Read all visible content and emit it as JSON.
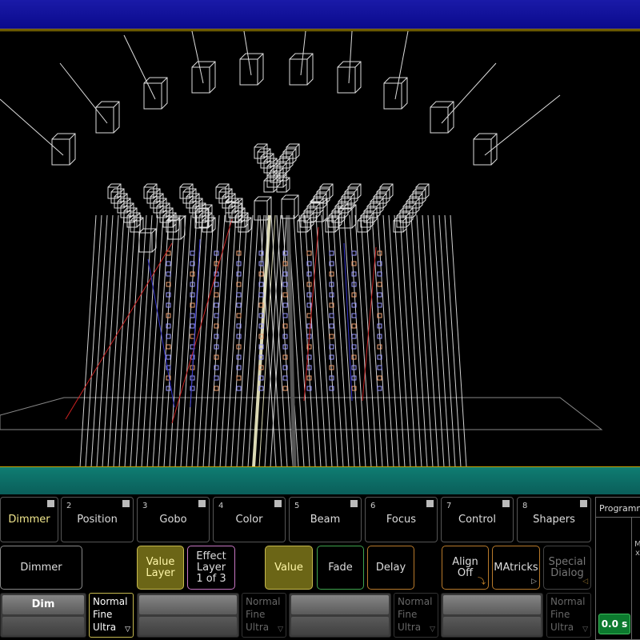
{
  "feature_tabs": [
    {
      "num": "",
      "label": "Dimmer",
      "active": true
    },
    {
      "num": "2",
      "label": "Position"
    },
    {
      "num": "3",
      "label": "Gobo"
    },
    {
      "num": "4",
      "label": "Color"
    },
    {
      "num": "5",
      "label": "Beam"
    },
    {
      "num": "6",
      "label": "Focus"
    },
    {
      "num": "7",
      "label": "Control"
    },
    {
      "num": "8",
      "label": "Shapers"
    }
  ],
  "attribute_button": "Dimmer",
  "layer_buttons": {
    "value_layer": [
      "Value",
      "Layer"
    ],
    "effect_layer": [
      "Effect",
      "Layer",
      "1 of 3"
    ],
    "value": "Value",
    "fade": "Fade",
    "delay": "Delay",
    "align": [
      "Align",
      "Off"
    ],
    "matricks": "MAtricks",
    "special_dialog": [
      "Special",
      "Dialog"
    ]
  },
  "encoder": {
    "name": "Dim"
  },
  "resolution_options": [
    "Normal",
    "Fine",
    "Ultra"
  ],
  "programmer": {
    "title": "Programmer",
    "side_m": "M",
    "side_x": "x",
    "timer": "0.0 s"
  },
  "colors": {
    "accent_yellow": "#c6b94e",
    "titlebar": "#0a0a8c",
    "statusbar": "#0a5e5a"
  }
}
